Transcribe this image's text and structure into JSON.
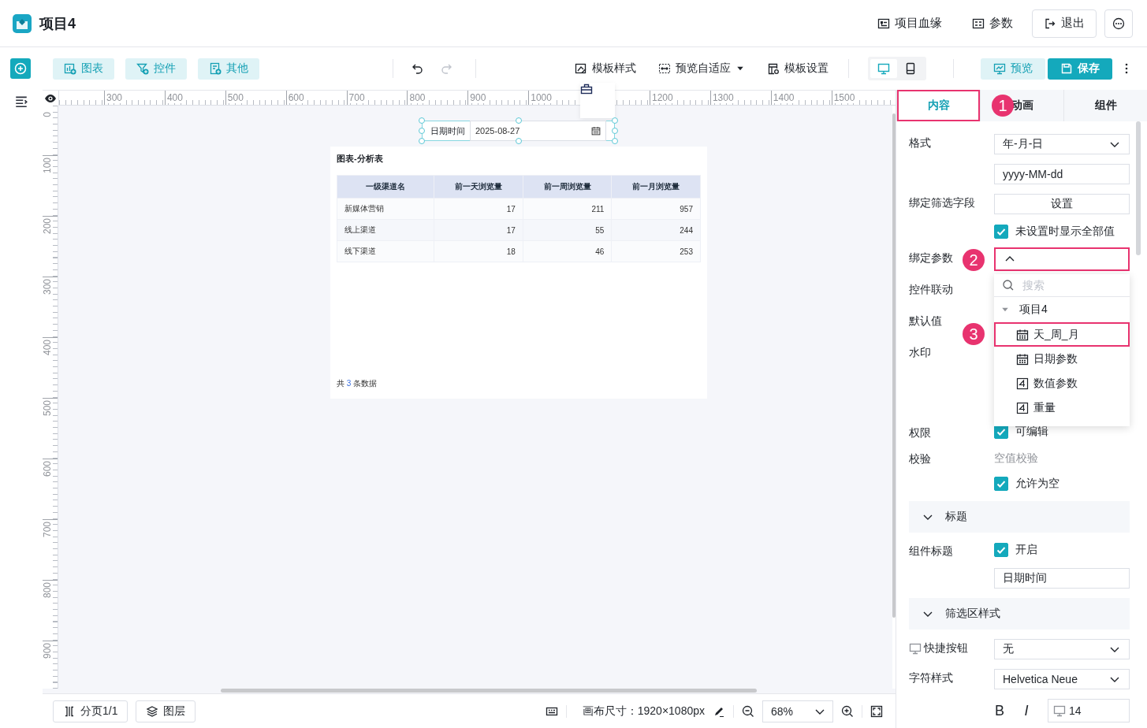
{
  "header": {
    "title": "项目4",
    "actions": [
      {
        "label": "项目血缘",
        "kind": "lineage"
      },
      {
        "label": "参数",
        "kind": "params"
      },
      {
        "label": "退出",
        "kind": "exit"
      }
    ]
  },
  "toolbar": {
    "insert_buttons": [
      {
        "label": "图表",
        "kind": "chart"
      },
      {
        "label": "控件",
        "kind": "control"
      },
      {
        "label": "其他",
        "kind": "other"
      }
    ],
    "history": [
      {
        "kind": "undo",
        "disabled": false
      },
      {
        "kind": "redo",
        "disabled": true
      }
    ],
    "template_buttons": [
      {
        "label": "模板样式",
        "kind": "style",
        "dropdown": false
      },
      {
        "label": "预览自适应",
        "kind": "fit",
        "dropdown": true
      },
      {
        "label": "模板设置",
        "kind": "settings",
        "dropdown": false
      }
    ],
    "devices": [
      {
        "kind": "desktop",
        "selected": true
      },
      {
        "kind": "mobile",
        "selected": false
      }
    ],
    "preview": "预览",
    "save": "保存"
  },
  "rulers": {
    "horizontal": [
      "300",
      "400",
      "500",
      "600",
      "700",
      "800",
      "900",
      "1000",
      "1200",
      "1300",
      "1400",
      "1500"
    ],
    "vertical": [
      "0",
      "100",
      "200",
      "300",
      "400",
      "500",
      "600",
      "700",
      "800",
      "900"
    ]
  },
  "canvas": {
    "date_widget": {
      "label": "日期时间",
      "value": "2025-08-27",
      "selected": true
    },
    "table_card": {
      "title": "图表-分析表",
      "columns": [
        "一级渠道名",
        "前一天浏览量",
        "前一周浏览量",
        "前一月浏览量"
      ],
      "rows": [
        [
          "新媒体营销",
          "17",
          "211",
          "957"
        ],
        [
          "线上渠道",
          "17",
          "55",
          "244"
        ],
        [
          "线下渠道",
          "18",
          "46",
          "253"
        ]
      ],
      "footer": {
        "before": "共",
        "count": "3",
        "after": "条数据"
      }
    }
  },
  "bottom_bar": {
    "pages": "分页1/1",
    "layers": "图层",
    "canvas_size": "画布尺寸：1920×1080px",
    "zoom": "68%"
  },
  "panel": {
    "tabs": [
      {
        "label": "内容",
        "selected": true,
        "highlighted": true,
        "marker": "1"
      },
      {
        "label": "动画",
        "selected": false,
        "highlighted": false
      },
      {
        "label": "组件",
        "selected": false,
        "highlighted": false
      }
    ],
    "form": [
      {
        "kind": "select",
        "label": "格式",
        "value": "年-月-日"
      },
      {
        "kind": "input",
        "value": "yyyy-MM-dd"
      },
      {
        "kind": "button",
        "label": "绑定筛选字段",
        "text": "设置"
      },
      {
        "kind": "checkbox",
        "text": "未设置时显示全部值",
        "checked": true
      },
      {
        "kind": "select",
        "label": "绑定参数",
        "open": true,
        "highlighted": true,
        "marker": "2"
      },
      {
        "kind": "covered",
        "label": "控件联动"
      },
      {
        "kind": "covered",
        "label": "默认值"
      },
      {
        "kind": "area",
        "label": "水印"
      },
      {
        "kind": "checkbox",
        "label": "权限",
        "text": "可编辑",
        "checked": true
      },
      {
        "kind": "note",
        "label": "校验",
        "text": "空值校验"
      },
      {
        "kind": "checkbox",
        "text": "允许为空",
        "checked": true
      },
      {
        "kind": "section",
        "text": "标题",
        "expanded": true
      },
      {
        "kind": "checkbox",
        "label": "组件标题",
        "text": "开启",
        "checked": true
      },
      {
        "kind": "input",
        "value": "日期时间"
      },
      {
        "kind": "section",
        "text": "筛选区样式",
        "expanded": true
      },
      {
        "kind": "select",
        "label": "快捷按钮",
        "label_icon": true,
        "value": "无"
      },
      {
        "kind": "select",
        "label": "字符样式",
        "value": "Helvetica Neue"
      },
      {
        "kind": "format",
        "bold": "B",
        "italic": "I",
        "size": "14"
      }
    ],
    "dropdown": {
      "search_placeholder": "搜索",
      "tree": [
        {
          "label": "项目4",
          "expanded": true,
          "children": [
            {
              "label": "天_周_月",
              "kind": "date",
              "highlighted": true,
              "marker": "3"
            },
            {
              "label": "日期参数",
              "kind": "date",
              "highlighted": false
            },
            {
              "label": "数值参数",
              "kind": "number",
              "highlighted": false
            },
            {
              "label": "重量",
              "kind": "number",
              "highlighted": false
            }
          ]
        }
      ]
    }
  }
}
